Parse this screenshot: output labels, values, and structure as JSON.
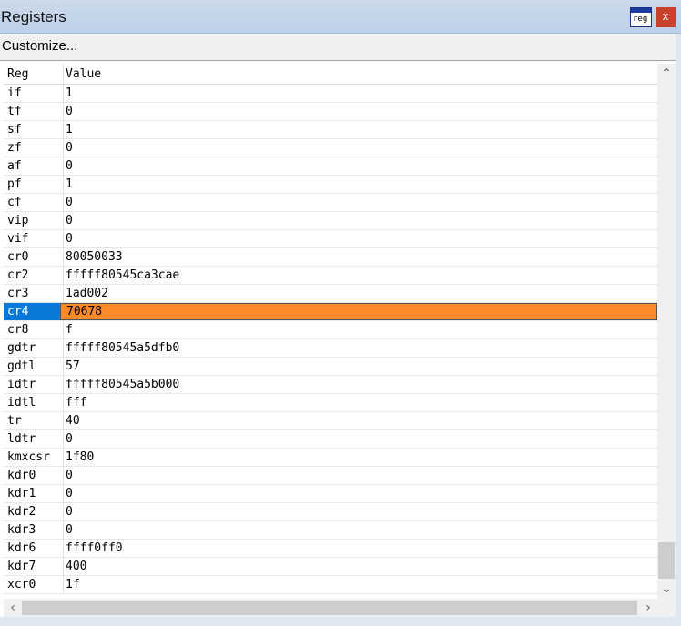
{
  "window": {
    "title": "Registers",
    "icon_text": "reg",
    "close_label": "x"
  },
  "toolbar": {
    "customize_label": "Customize..."
  },
  "grid": {
    "headers": {
      "reg": "Reg",
      "value": "Value"
    },
    "rows": [
      {
        "reg": "if",
        "value": "1"
      },
      {
        "reg": "tf",
        "value": "0"
      },
      {
        "reg": "sf",
        "value": "1"
      },
      {
        "reg": "zf",
        "value": "0"
      },
      {
        "reg": "af",
        "value": "0"
      },
      {
        "reg": "pf",
        "value": "1"
      },
      {
        "reg": "cf",
        "value": "0"
      },
      {
        "reg": "vip",
        "value": "0"
      },
      {
        "reg": "vif",
        "value": "0"
      },
      {
        "reg": "cr0",
        "value": "80050033"
      },
      {
        "reg": "cr2",
        "value": "fffff80545ca3cae"
      },
      {
        "reg": "cr3",
        "value": "1ad002"
      },
      {
        "reg": "cr4",
        "value": "70678",
        "selected": true
      },
      {
        "reg": "cr8",
        "value": "f"
      },
      {
        "reg": "gdtr",
        "value": "fffff80545a5dfb0"
      },
      {
        "reg": "gdtl",
        "value": "57"
      },
      {
        "reg": "idtr",
        "value": "fffff80545a5b000"
      },
      {
        "reg": "idtl",
        "value": "fff"
      },
      {
        "reg": "tr",
        "value": "40"
      },
      {
        "reg": "ldtr",
        "value": "0"
      },
      {
        "reg": "kmxcsr",
        "value": "1f80"
      },
      {
        "reg": "kdr0",
        "value": "0"
      },
      {
        "reg": "kdr1",
        "value": "0"
      },
      {
        "reg": "kdr2",
        "value": "0"
      },
      {
        "reg": "kdr3",
        "value": "0"
      },
      {
        "reg": "kdr6",
        "value": "ffff0ff0"
      },
      {
        "reg": "kdr7",
        "value": "400"
      },
      {
        "reg": "xcr0",
        "value": "1f"
      }
    ]
  },
  "colors": {
    "selected_name_bg": "#0a78d7",
    "selected_value_bg": "#ff8a2a",
    "titlebar": "#c4d5ea",
    "close_button": "#c8412d"
  },
  "icons": {
    "scroll_up": "▲-chevron",
    "scroll_down": "▼-chevron",
    "scroll_left": "‹",
    "scroll_right": "›"
  }
}
